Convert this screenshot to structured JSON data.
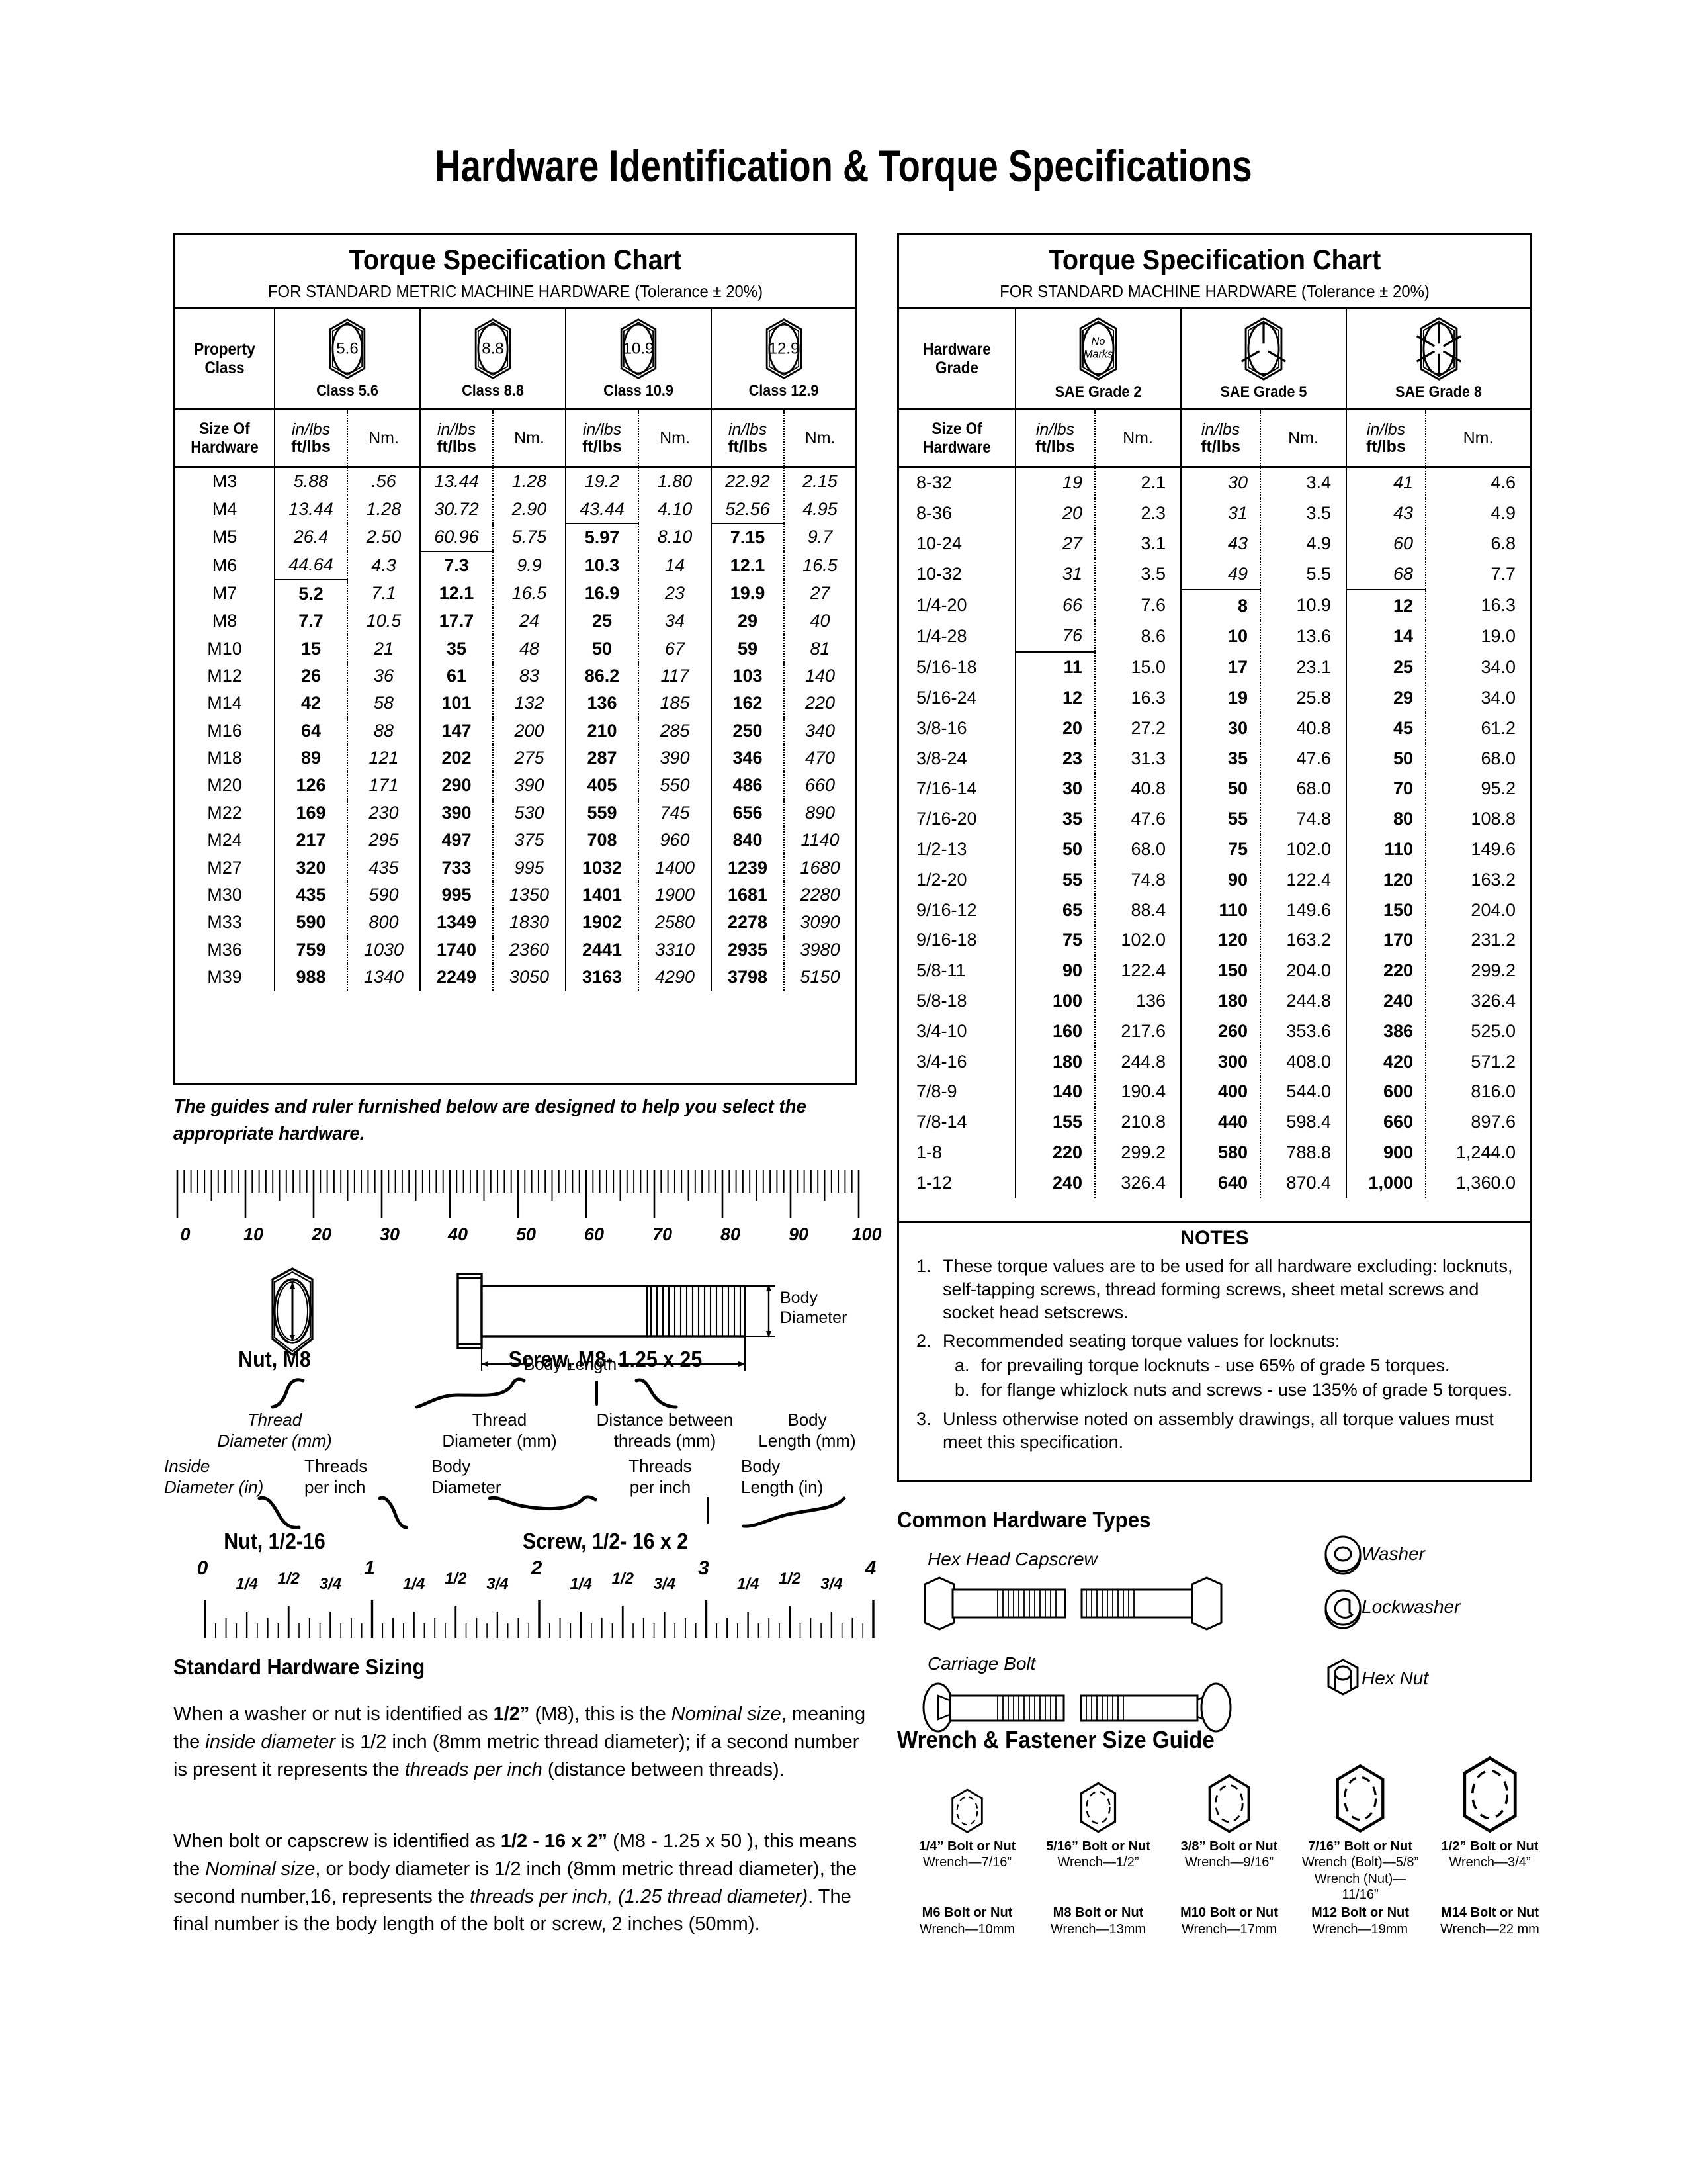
{
  "page_title": "Hardware Identification  &  Torque Specifications",
  "metric_table": {
    "title": "Torque Specification Chart",
    "subtitle": "FOR STANDARD METRIC MACHINE HARDWARE (Tolerance ± 20%)",
    "grade_row_label": "Property Class",
    "grade_row_label_l1": "Property",
    "grade_row_label_l2": "Class",
    "size_label_l1": "Size Of",
    "size_label_l2": "Hardware",
    "unit_inlbs": "in/lbs",
    "unit_ftlbs": "ft/lbs",
    "unit_nm": "Nm.",
    "classes": [
      {
        "mark": "5.6",
        "label": "Class 5.6"
      },
      {
        "mark": "8.8",
        "label": "Class 8.8"
      },
      {
        "mark": "10.9",
        "label": "Class 10.9"
      },
      {
        "mark": "12.9",
        "label": "Class 12.9"
      }
    ],
    "rows": [
      {
        "size": "M3",
        "c": [
          "5.88",
          ".56",
          "13.44",
          "1.28",
          "19.2",
          "1.80",
          "22.92",
          "2.15"
        ]
      },
      {
        "size": "M4",
        "c": [
          "13.44",
          "1.28",
          "30.72",
          "2.90",
          "43.44",
          "4.10",
          "52.56",
          "4.95"
        ]
      },
      {
        "size": "M5",
        "c": [
          "26.4",
          "2.50",
          "60.96",
          "5.75",
          "5.97",
          "8.10",
          "7.15",
          "9.7"
        ]
      },
      {
        "size": "M6",
        "c": [
          "44.64",
          "4.3",
          "7.3",
          "9.9",
          "10.3",
          "14",
          "12.1",
          "16.5"
        ]
      },
      {
        "size": "M7",
        "c": [
          "5.2",
          "7.1",
          "12.1",
          "16.5",
          "16.9",
          "23",
          "19.9",
          "27"
        ]
      },
      {
        "size": "M8",
        "c": [
          "7.7",
          "10.5",
          "17.7",
          "24",
          "25",
          "34",
          "29",
          "40"
        ]
      },
      {
        "size": "M10",
        "c": [
          "15",
          "21",
          "35",
          "48",
          "50",
          "67",
          "59",
          "81"
        ]
      },
      {
        "size": "M12",
        "c": [
          "26",
          "36",
          "61",
          "83",
          "86.2",
          "117",
          "103",
          "140"
        ]
      },
      {
        "size": "M14",
        "c": [
          "42",
          "58",
          "101",
          "132",
          "136",
          "185",
          "162",
          "220"
        ]
      },
      {
        "size": "M16",
        "c": [
          "64",
          "88",
          "147",
          "200",
          "210",
          "285",
          "250",
          "340"
        ]
      },
      {
        "size": "M18",
        "c": [
          "89",
          "121",
          "202",
          "275",
          "287",
          "390",
          "346",
          "470"
        ]
      },
      {
        "size": "M20",
        "c": [
          "126",
          "171",
          "290",
          "390",
          "405",
          "550",
          "486",
          "660"
        ]
      },
      {
        "size": "M22",
        "c": [
          "169",
          "230",
          "390",
          "530",
          "559",
          "745",
          "656",
          "890"
        ]
      },
      {
        "size": "M24",
        "c": [
          "217",
          "295",
          "497",
          "375",
          "708",
          "960",
          "840",
          "1140"
        ]
      },
      {
        "size": "M27",
        "c": [
          "320",
          "435",
          "733",
          "995",
          "1032",
          "1400",
          "1239",
          "1680"
        ]
      },
      {
        "size": "M30",
        "c": [
          "435",
          "590",
          "995",
          "1350",
          "1401",
          "1900",
          "1681",
          "2280"
        ]
      },
      {
        "size": "M33",
        "c": [
          "590",
          "800",
          "1349",
          "1830",
          "1902",
          "2580",
          "2278",
          "3090"
        ]
      },
      {
        "size": "M36",
        "c": [
          "759",
          "1030",
          "1740",
          "2360",
          "2441",
          "3310",
          "2935",
          "3980"
        ]
      },
      {
        "size": "M39",
        "c": [
          "988",
          "1340",
          "2249",
          "3050",
          "3163",
          "4290",
          "3798",
          "5150"
        ]
      }
    ]
  },
  "sae_table": {
    "title": "Torque Specification Chart",
    "subtitle": "FOR STANDARD MACHINE HARDWARE (Tolerance ± 20%)",
    "grade_row_label_l1": "Hardware",
    "grade_row_label_l2": "Grade",
    "size_label_l1": "Size Of",
    "size_label_l2": "Hardware",
    "unit_inlbs": "in/lbs",
    "unit_ftlbs": "ft/lbs",
    "unit_nm": "Nm.",
    "grades": [
      {
        "mark": "No Marks",
        "label": "SAE Grade 2"
      },
      {
        "mark": "3-lines",
        "label": "SAE Grade 5"
      },
      {
        "mark": "6-lines",
        "label": "SAE Grade 8"
      }
    ],
    "rows": [
      {
        "size": "8-32",
        "c": [
          "19",
          "2.1",
          "30",
          "3.4",
          "41",
          "4.6"
        ]
      },
      {
        "size": "8-36",
        "c": [
          "20",
          "2.3",
          "31",
          "3.5",
          "43",
          "4.9"
        ]
      },
      {
        "size": "10-24",
        "c": [
          "27",
          "3.1",
          "43",
          "4.9",
          "60",
          "6.8"
        ]
      },
      {
        "size": "10-32",
        "c": [
          "31",
          "3.5",
          "49",
          "5.5",
          "68",
          "7.7"
        ]
      },
      {
        "size": "1/4-20",
        "c": [
          "66",
          "7.6",
          "8",
          "10.9",
          "12",
          "16.3"
        ]
      },
      {
        "size": "1/4-28",
        "c": [
          "76",
          "8.6",
          "10",
          "13.6",
          "14",
          "19.0"
        ]
      },
      {
        "size": "5/16-18",
        "c": [
          "11",
          "15.0",
          "17",
          "23.1",
          "25",
          "34.0"
        ]
      },
      {
        "size": "5/16-24",
        "c": [
          "12",
          "16.3",
          "19",
          "25.8",
          "29",
          "34.0"
        ]
      },
      {
        "size": "3/8-16",
        "c": [
          "20",
          "27.2",
          "30",
          "40.8",
          "45",
          "61.2"
        ]
      },
      {
        "size": "3/8-24",
        "c": [
          "23",
          "31.3",
          "35",
          "47.6",
          "50",
          "68.0"
        ]
      },
      {
        "size": "7/16-14",
        "c": [
          "30",
          "40.8",
          "50",
          "68.0",
          "70",
          "95.2"
        ]
      },
      {
        "size": "7/16-20",
        "c": [
          "35",
          "47.6",
          "55",
          "74.8",
          "80",
          "108.8"
        ]
      },
      {
        "size": "1/2-13",
        "c": [
          "50",
          "68.0",
          "75",
          "102.0",
          "110",
          "149.6"
        ]
      },
      {
        "size": "1/2-20",
        "c": [
          "55",
          "74.8",
          "90",
          "122.4",
          "120",
          "163.2"
        ]
      },
      {
        "size": "9/16-12",
        "c": [
          "65",
          "88.4",
          "110",
          "149.6",
          "150",
          "204.0"
        ]
      },
      {
        "size": "9/16-18",
        "c": [
          "75",
          "102.0",
          "120",
          "163.2",
          "170",
          "231.2"
        ]
      },
      {
        "size": "5/8-11",
        "c": [
          "90",
          "122.4",
          "150",
          "204.0",
          "220",
          "299.2"
        ]
      },
      {
        "size": "5/8-18",
        "c": [
          "100",
          "136",
          "180",
          "244.8",
          "240",
          "326.4"
        ]
      },
      {
        "size": "3/4-10",
        "c": [
          "160",
          "217.6",
          "260",
          "353.6",
          "386",
          "525.0"
        ]
      },
      {
        "size": "3/4-16",
        "c": [
          "180",
          "244.8",
          "300",
          "408.0",
          "420",
          "571.2"
        ]
      },
      {
        "size": "7/8-9",
        "c": [
          "140",
          "190.4",
          "400",
          "544.0",
          "600",
          "816.0"
        ]
      },
      {
        "size": "7/8-14",
        "c": [
          "155",
          "210.8",
          "440",
          "598.4",
          "660",
          "897.6"
        ]
      },
      {
        "size": "1-8",
        "c": [
          "220",
          "299.2",
          "580",
          "788.8",
          "900",
          "1,244.0"
        ]
      },
      {
        "size": "1-12",
        "c": [
          "240",
          "326.4",
          "640",
          "870.4",
          "1,000",
          "1,360.0"
        ]
      }
    ]
  },
  "notes": {
    "title": "NOTES",
    "items": [
      {
        "n": "1.",
        "text": "These torque values are to be used for all hardware excluding: locknuts, self-tapping screws, thread forming screws, sheet metal screws and socket head setscrews."
      },
      {
        "n": "2.",
        "text": "Recommended seating torque values for locknuts:"
      },
      {
        "n": "3.",
        "text": "Unless otherwise noted on assembly drawings, all torque values must meet this specification."
      }
    ],
    "subitems": [
      {
        "n": "a.",
        "text": "for prevailing torque locknuts - use 65% of grade 5 torques."
      },
      {
        "n": "b.",
        "text": "for flange whizlock nuts and screws - use 135% of grade 5 torques."
      }
    ]
  },
  "guide_note": "The guides and ruler furnished below are designed to help you select the appropriate hardware.",
  "mm_ruler": {
    "ticks": [
      "0",
      "10",
      "20",
      "30",
      "40",
      "50",
      "60",
      "70",
      "80",
      "90",
      "100"
    ]
  },
  "inch_ruler": {
    "whole": [
      "0",
      "1",
      "2",
      "3",
      "4"
    ],
    "fractions": [
      "1/4",
      "1/2",
      "3/4"
    ]
  },
  "diagrams": {
    "body_diameter_label_l1": "Body",
    "body_diameter_label_l2": "Diameter",
    "body_length_label": "Body Length",
    "nut_metric_caption": "Nut, M8",
    "screw_metric_caption": "Screw, M8- 1.25 x 25",
    "nut_inch_caption": "Nut, 1/2-16",
    "screw_inch_caption": "Screw, 1/2- 16 x 2",
    "nut_metric_labels": [
      "Thread",
      "Diameter (mm)"
    ],
    "nut_inch_labels_a": [
      "Inside",
      "Diameter (in)"
    ],
    "nut_inch_labels_b": [
      "Threads",
      "per inch"
    ],
    "screw_metric_labels": [
      [
        "Thread",
        "Diameter (mm)"
      ],
      [
        "Distance between",
        "threads (mm)"
      ],
      [
        "Body",
        "Length (mm)"
      ]
    ],
    "screw_inch_labels": [
      [
        "Body",
        "Diameter"
      ],
      [
        "Threads",
        "per inch"
      ],
      [
        "Body",
        "Length (in)"
      ]
    ]
  },
  "sizing": {
    "heading": "Standard Hardware Sizing",
    "para1_a": "When a washer or nut is identified as ",
    "para1_b": "1/2”",
    "para1_c": " (M8), this is the ",
    "para1_d": "Nominal size",
    "para1_e": ", meaning the ",
    "para1_f": "inside diameter",
    "para1_g": " is 1/2 inch (8mm metric thread diameter); if a second number is present it represents the ",
    "para1_h": "threads per inch",
    "para1_i": " (distance between threads).",
    "para2_a": "When bolt or capscrew is identified as ",
    "para2_b": "1/2 - 16 x 2”",
    "para2_c": " (M8 - 1.25 x 50 ), this means the ",
    "para2_d": "Nominal size",
    "para2_e": ", or body diameter is 1/2 inch (8mm metric thread diameter), the second number,16, represents the ",
    "para2_f": "threads per inch, (1.25 thread diameter)",
    "para2_g": ". The final number is the body length of the bolt or screw, 2 inches (50mm)."
  },
  "common_hardware": {
    "heading": "Common Hardware Types",
    "hex_head_capscrew": "Hex Head Capscrew",
    "carriage_bolt": "Carriage Bolt",
    "washer": "Washer",
    "lockwasher": "Lockwasher",
    "hex_nut": "Hex Nut"
  },
  "wrench_guide": {
    "heading": "Wrench & Fastener Size Guide",
    "imperial": [
      {
        "size": "1/4” Bolt or Nut",
        "wrench": "Wrench—7/16”"
      },
      {
        "size": "5/16” Bolt or Nut",
        "wrench": "Wrench—1/2”"
      },
      {
        "size": "3/8” Bolt or Nut",
        "wrench": "Wrench—9/16”"
      },
      {
        "size": "7/16” Bolt or Nut",
        "wrench": "Wrench (Bolt)—5/8”",
        "wrench2": "Wrench (Nut)—11/16”"
      },
      {
        "size": "1/2” Bolt or Nut",
        "wrench": "Wrench—3/4”"
      }
    ],
    "metric": [
      {
        "size": "M6 Bolt or Nut",
        "wrench": "Wrench—10mm"
      },
      {
        "size": "M8 Bolt or Nut",
        "wrench": "Wrench—13mm"
      },
      {
        "size": "M10 Bolt or Nut",
        "wrench": "Wrench—17mm"
      },
      {
        "size": "M12 Bolt or Nut",
        "wrench": "Wrench—19mm"
      },
      {
        "size": "M14 Bolt or Nut",
        "wrench": "Wrench—22 mm"
      }
    ]
  }
}
